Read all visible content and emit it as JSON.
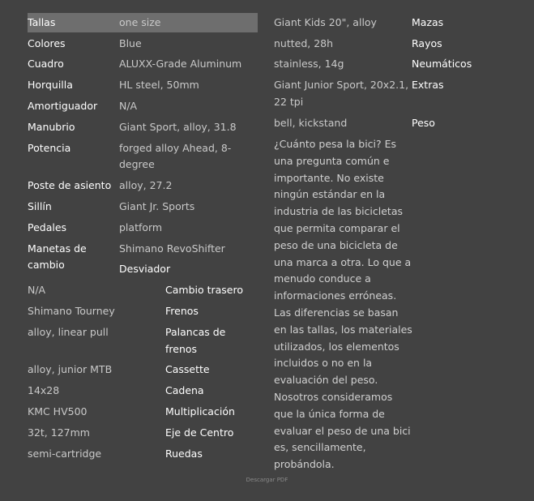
{
  "specs_left": {
    "tallas": {
      "label": "Tallas",
      "value": "one size"
    },
    "colores": {
      "label": "Colores",
      "value": "Blue"
    },
    "cuadro": {
      "label": "Cuadro",
      "value": "ALUXX-Grade Aluminum"
    },
    "horquilla": {
      "label": "Horquilla",
      "value": "HL steel, 50mm"
    },
    "amortiguador": {
      "label": "Amortiguador",
      "value": "N/A"
    },
    "manubrio": {
      "label": "Manubrio",
      "value": "Giant Sport, alloy, 31.8"
    },
    "potencia": {
      "label": "Potencia",
      "value_line1": "forged alloy Ahead, 8-",
      "value_line2": "degree"
    },
    "poste": {
      "label": "Poste de asiento",
      "value": "alloy, 27.2"
    },
    "sillin": {
      "label": "Sillín",
      "value": "Giant Jr. Sports"
    },
    "pedales": {
      "label": "Pedales",
      "value": "platform"
    },
    "manetas": {
      "label_line1": "Manetas de",
      "label_line2": "cambio",
      "value": "Shimano RevoShifter"
    },
    "desviador": {
      "label": "Desviador"
    }
  },
  "specs_middle": {
    "desviador_value": "N/A",
    "cambio_trasero": {
      "label": "Cambio trasero",
      "value": "Shimano Tourney"
    },
    "frenos": {
      "label": "Frenos",
      "value": "alloy, linear pull"
    },
    "palancas": {
      "label_line1": "Palancas de",
      "label_line2": "frenos",
      "value": "alloy, junior MTB"
    },
    "cassette": {
      "label": "Cassette",
      "value": "14x28"
    },
    "cadena": {
      "label": "Cadena",
      "value": "KMC HV500"
    },
    "multiplicacion": {
      "label": "Multiplicación",
      "value": "32t, 127mm"
    },
    "eje": {
      "label": "Eje de Centro",
      "value": "semi-cartridge"
    },
    "ruedas": {
      "label": "Ruedas",
      "value": "Giant Kids 20\", alloy"
    }
  },
  "specs_right": {
    "mazas": {
      "label": "Mazas",
      "value": "nutted, 28h"
    },
    "rayos": {
      "label": "Rayos",
      "value": "stainless, 14g"
    },
    "neumaticos": {
      "label": "Neumáticos",
      "value_line1": "Giant Junior Sport, 20x2.1,",
      "value_line2": "22 tpi"
    },
    "extras": {
      "label": "Extras",
      "value": "bell, kickstand"
    },
    "peso": {
      "label": "Peso"
    }
  },
  "weight_text": "¿Cuánto pesa la bici? Es una pregunta común e importante. No existe ningún estándar en la industria de las bicicletas que permita comparar el peso de una bicicleta de una marca a otra. Lo que a menudo conduce a informaciones erróneas. Las diferencias se basan en las tallas, los materiales utilizados, los elementos incluidos o no en la evaluación del peso. Nosotros consideramos que la única forma de evaluar el peso de una bici es, sencillamente, probándola.",
  "download_label": "Descargar PDF"
}
